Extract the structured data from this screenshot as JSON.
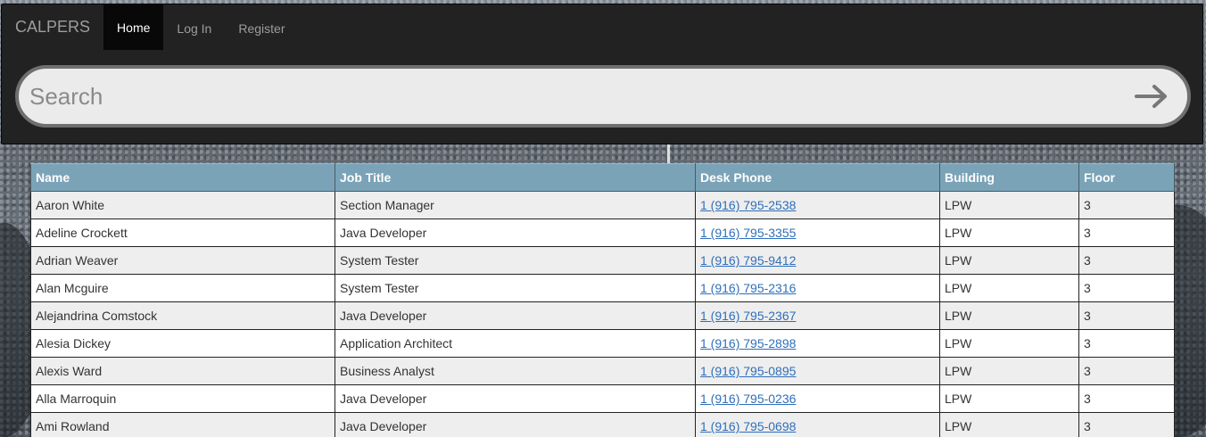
{
  "navbar": {
    "brand": "CALPERS",
    "links": [
      {
        "label": "Home",
        "active": true
      },
      {
        "label": "Log In",
        "active": false
      },
      {
        "label": "Register",
        "active": false
      }
    ]
  },
  "search": {
    "placeholder": "Search",
    "value": "",
    "button_icon": "arrow-right-icon"
  },
  "table": {
    "headers": [
      "Name",
      "Job Title",
      "Desk Phone",
      "Building",
      "Floor"
    ],
    "rows": [
      [
        "Aaron White",
        "Section Manager",
        "1 (916) 795-2538",
        "LPW",
        "3"
      ],
      [
        "Adeline Crockett",
        "Java Developer",
        "1 (916) 795-3355",
        "LPW",
        "3"
      ],
      [
        "Adrian Weaver",
        "System Tester",
        "1 (916) 795-9412",
        "LPW",
        "3"
      ],
      [
        "Alan Mcguire",
        "System Tester",
        "1 (916) 795-2316",
        "LPW",
        "3"
      ],
      [
        "Alejandrina Comstock",
        "Java Developer",
        "1 (916) 795-2367",
        "LPW",
        "3"
      ],
      [
        "Alesia Dickey",
        "Application Architect",
        "1 (916) 795-2898",
        "LPW",
        "3"
      ],
      [
        "Alexis Ward",
        "Business Analyst",
        "1 (916) 795-0895",
        "LPW",
        "3"
      ],
      [
        "Alla Marroquin",
        "Java Developer",
        "1 (916) 795-0236",
        "LPW",
        "3"
      ],
      [
        "Ami Rowland",
        "Java Developer",
        "1 (916) 795-0698",
        "LPW",
        "3"
      ]
    ]
  },
  "colors": {
    "navbar_bg": "#222222",
    "header_bg": "#7ba3b8",
    "link": "#2f6fba",
    "row_alt": "#eeeeee"
  }
}
